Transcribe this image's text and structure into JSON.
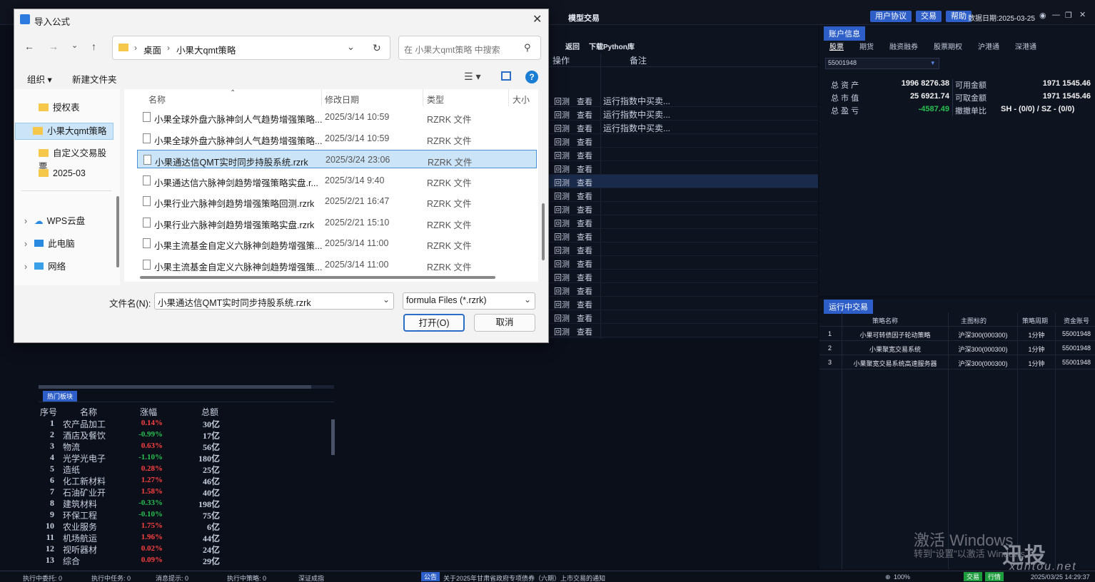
{
  "app": {
    "title": "模型交易",
    "header_buttons": [
      "用户协议",
      "交易",
      "帮助"
    ],
    "data_date": "数据日期:2025-03-25"
  },
  "mid": {
    "toolbar": [
      "返回",
      "下载Python库"
    ],
    "col_op": "操作",
    "col_note": "备注",
    "rows": [
      {
        "a": "回测",
        "b": "查看",
        "note": "运行指数中买卖..."
      },
      {
        "a": "回测",
        "b": "查看",
        "note": "运行指数中买卖..."
      },
      {
        "a": "回测",
        "b": "查看",
        "note": "运行指数中买卖..."
      },
      {
        "a": "回测",
        "b": "查看",
        "note": ""
      },
      {
        "a": "回测",
        "b": "查看",
        "note": ""
      },
      {
        "a": "回测",
        "b": "查看",
        "note": ""
      },
      {
        "a": "回测",
        "b": "查看",
        "note": ""
      },
      {
        "a": "回测",
        "b": "查看",
        "note": ""
      },
      {
        "a": "回测",
        "b": "查看",
        "note": ""
      },
      {
        "a": "回测",
        "b": "查看",
        "note": ""
      },
      {
        "a": "回测",
        "b": "查看",
        "note": ""
      },
      {
        "a": "回测",
        "b": "查看",
        "note": ""
      },
      {
        "a": "回测",
        "b": "查看",
        "note": ""
      },
      {
        "a": "回测",
        "b": "查看",
        "note": ""
      },
      {
        "a": "回测",
        "b": "查看",
        "note": ""
      },
      {
        "a": "回测",
        "b": "查看",
        "note": ""
      },
      {
        "a": "回测",
        "b": "查看",
        "note": ""
      },
      {
        "a": "回测",
        "b": "查看",
        "note": ""
      }
    ]
  },
  "account": {
    "tab": "账户信息",
    "subtabs": [
      "股票",
      "期货",
      "融资融券",
      "股票期权",
      "沪港通",
      "深港通"
    ],
    "account_no": "55001948",
    "lines": [
      {
        "l1": "总 资 产",
        "v1": "1996 8276.38",
        "l2": "可用金额",
        "v2": "1971 1545.46"
      },
      {
        "l1": "总 市 值",
        "v1": "25 6921.74",
        "l2": "可取金额",
        "v2": "1971 1545.46"
      },
      {
        "l1": "总 盈 亏",
        "v1": "-4587.49",
        "l2": "撤撤单比",
        "v2": "SH - (0/0) / SZ - (0/0)"
      }
    ]
  },
  "running": {
    "tab": "运行中交易",
    "headers": [
      "策略名称",
      "主图标的",
      "策略周期",
      "资金账号"
    ],
    "rows": [
      {
        "n": "1",
        "name": "小果可转债因子轮动策略",
        "idx": "沪深300(000300)",
        "period": "1分钟",
        "acct": "55001948"
      },
      {
        "n": "2",
        "name": "小果聚宽交易系统",
        "idx": "沪深300(000300)",
        "period": "1分钟",
        "acct": "55001948"
      },
      {
        "n": "3",
        "name": "小果聚宽交易系统高速服务器",
        "idx": "沪深300(000300)",
        "period": "1分钟",
        "acct": "55001948"
      }
    ]
  },
  "hot": {
    "tab": "热门板块",
    "headers": [
      "序号",
      "名称",
      "涨幅",
      "总额"
    ],
    "rows": [
      {
        "n": "1",
        "name": "农产品加工",
        "pct": "0.14%",
        "amt": "30亿",
        "up": true
      },
      {
        "n": "2",
        "name": "酒店及餐饮",
        "pct": "-0.99%",
        "amt": "17亿",
        "up": false
      },
      {
        "n": "3",
        "name": "物流",
        "pct": "0.63%",
        "amt": "56亿",
        "up": true
      },
      {
        "n": "4",
        "name": "光学光电子",
        "pct": "-1.10%",
        "amt": "180亿",
        "up": false
      },
      {
        "n": "5",
        "name": "造纸",
        "pct": "0.28%",
        "amt": "25亿",
        "up": true
      },
      {
        "n": "6",
        "name": "化工新材料",
        "pct": "1.27%",
        "amt": "46亿",
        "up": true
      },
      {
        "n": "7",
        "name": "石油矿业开",
        "pct": "1.58%",
        "amt": "40亿",
        "up": true
      },
      {
        "n": "8",
        "name": "建筑材料",
        "pct": "-0.33%",
        "amt": "198亿",
        "up": false
      },
      {
        "n": "9",
        "name": "环保工程",
        "pct": "-0.10%",
        "amt": "75亿",
        "up": false
      },
      {
        "n": "10",
        "name": "农业服务",
        "pct": "1.75%",
        "amt": "6亿",
        "up": true
      },
      {
        "n": "11",
        "name": "机场航运",
        "pct": "1.96%",
        "amt": "44亿",
        "up": true
      },
      {
        "n": "12",
        "name": "视听器材",
        "pct": "0.02%",
        "amt": "24亿",
        "up": true
      },
      {
        "n": "13",
        "name": "综合",
        "pct": "0.09%",
        "amt": "29亿",
        "up": true
      }
    ]
  },
  "status": {
    "items": [
      "执行中委托: 0",
      "执行中任务: 0",
      "消息提示: 0",
      "执行中策略: 0"
    ],
    "index": "深证成指",
    "notice_tag": "公告",
    "notice": "关于2025年甘肃省政府专项债券（六期）上市交易的通知",
    "zoom": "100%",
    "btn1": "交易",
    "btn2": "行情",
    "datetime": "2025/03/25 14:29:37"
  },
  "watermark": {
    "line1": "激活 Windows",
    "line2": "转到“设置”以激活 Windows。",
    "brand": "迅投QMT",
    "site": "xuntou.net"
  },
  "dialog": {
    "title": "导入公式",
    "path": [
      "桌面",
      "小果大qmt策略"
    ],
    "search_placeholder": "在 小果大qmt策略 中搜索",
    "organize": "组织 ▾",
    "new_folder": "新建文件夹",
    "nav": [
      "授权表",
      "小果大qmt策略",
      "自定义交易股票",
      "2025-03",
      "WPS云盘",
      "此电脑",
      "网络"
    ],
    "headers": [
      "名称",
      "修改日期",
      "类型",
      "大小"
    ],
    "files": [
      {
        "name": "小果全球外盘六脉神剑人气趋势增强策略...",
        "date": "2025/3/14 10:59",
        "type": "RZRK 文件"
      },
      {
        "name": "小果全球外盘六脉神剑人气趋势增强策略...",
        "date": "2025/3/14 10:59",
        "type": "RZRK 文件"
      },
      {
        "name": "小果通达信QMT实时同步持股系统.rzrk",
        "date": "2025/3/24 23:06",
        "type": "RZRK 文件"
      },
      {
        "name": "小果通达信六脉神剑趋势增强策略实盘.r...",
        "date": "2025/3/14 9:40",
        "type": "RZRK 文件"
      },
      {
        "name": "小果行业六脉神剑趋势增强策略回测.rzrk",
        "date": "2025/2/21 16:47",
        "type": "RZRK 文件"
      },
      {
        "name": "小果行业六脉神剑趋势增强策略实盘.rzrk",
        "date": "2025/2/21 15:10",
        "type": "RZRK 文件"
      },
      {
        "name": "小果主流基金自定义六脉神剑趋势增强策...",
        "date": "2025/3/14 11:00",
        "type": "RZRK 文件"
      },
      {
        "name": "小果主流基金自定义六脉神剑趋势增强策...",
        "date": "2025/3/14 11:00",
        "type": "RZRK 文件"
      }
    ],
    "filename_label": "文件名(N):",
    "filename": "小果通达信QMT实时同步持股系统.rzrk",
    "filter": "formula Files (*.rzrk)",
    "open": "打开(O)",
    "cancel": "取消"
  }
}
